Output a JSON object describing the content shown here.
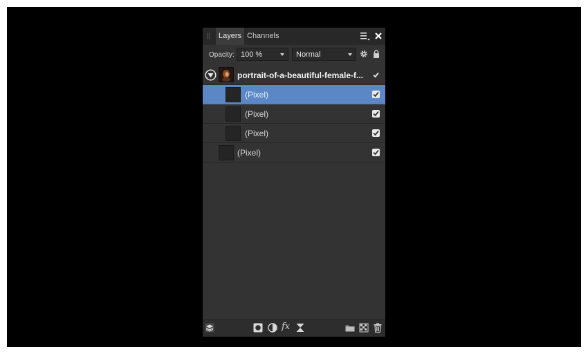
{
  "tabs": [
    {
      "label": "Layers",
      "active": true
    },
    {
      "label": "Channels",
      "active": false
    }
  ],
  "options": {
    "opacity_label": "Opacity:",
    "opacity_value": "100 %",
    "blend_mode": "Normal"
  },
  "layers": {
    "group": {
      "label": "portrait-of-a-beautiful-female-f...",
      "visible": true,
      "expanded": true
    },
    "children": [
      {
        "label": "(Pixel)",
        "visible": true,
        "selected": true
      },
      {
        "label": "(Pixel)",
        "visible": true,
        "selected": false
      },
      {
        "label": "(Pixel)",
        "visible": true,
        "selected": false
      }
    ],
    "root_layer": {
      "label": "(Pixel)",
      "visible": true
    }
  },
  "toolbar": {
    "fx_label": "fx",
    "icons": [
      "layers-stack-icon",
      "mask-icon",
      "adjustment-icon",
      "fx-icon",
      "live-filter-icon",
      "folder-icon",
      "new-pixel-layer-icon",
      "trash-icon"
    ]
  },
  "colors": {
    "selected_row": "#5b87c7",
    "panel_bg": "#333333",
    "background": "#000000"
  }
}
